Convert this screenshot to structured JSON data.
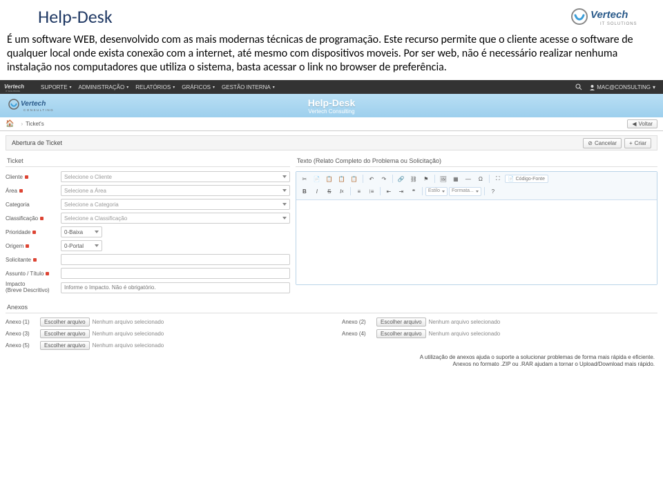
{
  "page": {
    "title": "Help-Desk",
    "description": "É um software WEB, desenvolvido com as mais modernas técnicas de programação. Este recurso permite que o cliente acesse o software de qualquer local onde exista conexão com a internet, até mesmo com dispositivos moveis. Por ser web, não é necessário realizar nenhuma instalação nos computadores que utiliza o sistema, basta acessar o link no browser de preferência."
  },
  "logo": {
    "brand": "Vertech",
    "subtitle": "IT SOLUTIONS"
  },
  "topnav": {
    "items": [
      "SUPORTE",
      "ADMINISTRAÇÃO",
      "RELATÓRIOS",
      "GRÁFICOS",
      "GESTÃO INTERNA"
    ],
    "user": "MAC@CONSULTING"
  },
  "banner": {
    "title": "Help-Desk",
    "sub": "Vertech Consulting",
    "sideBrand": "Vertech",
    "sideSub": "CONSULTING"
  },
  "crumbs": {
    "item1": "Ticket's",
    "voltar": "Voltar"
  },
  "section": {
    "title": "Abertura de Ticket",
    "cancel": "Cancelar",
    "create": "Criar"
  },
  "form": {
    "ticketHead": "Ticket",
    "cliente": {
      "label": "Cliente",
      "placeholder": "Selecione o Cliente"
    },
    "area": {
      "label": "Área",
      "placeholder": "Selecione a Área"
    },
    "categoria": {
      "label": "Categoria",
      "placeholder": "Selecione a Categoria"
    },
    "classificacao": {
      "label": "Classificação",
      "placeholder": "Selecione a Classificação"
    },
    "prioridade": {
      "label": "Prioridade",
      "value": "0-Baixa"
    },
    "origem": {
      "label": "Origem",
      "value": "0-Portal"
    },
    "solicitante": {
      "label": "Solicitante"
    },
    "assunto": {
      "label": "Assunto / Título"
    },
    "impacto": {
      "label1": "Impacto",
      "label2": "(Breve Descritivo)",
      "placeholder": "Informe o Impacto. Não é obrigatório."
    }
  },
  "editor": {
    "head": "Texto (Relato Completo do Problema ou Solicitação)",
    "styleSel": "Estilo",
    "formatSel": "Formata...",
    "codeBtn": "Código-Fonte"
  },
  "anexos": {
    "head": "Anexos",
    "items": [
      {
        "label": "Anexo (1)"
      },
      {
        "label": "Anexo (2)"
      },
      {
        "label": "Anexo (3)"
      },
      {
        "label": "Anexo (4)"
      },
      {
        "label": "Anexo (5)"
      }
    ],
    "fileBtn": "Escolher arquivo",
    "fileStatus": "Nenhum arquivo selecionado",
    "note1": "A utilização de anexos ajuda o suporte a solucionar problemas de forma mais rápida e eficiente.",
    "note2": "Anexos no formato .ZIP ou .RAR ajudam a tornar o Upload/Download mais rápido."
  }
}
